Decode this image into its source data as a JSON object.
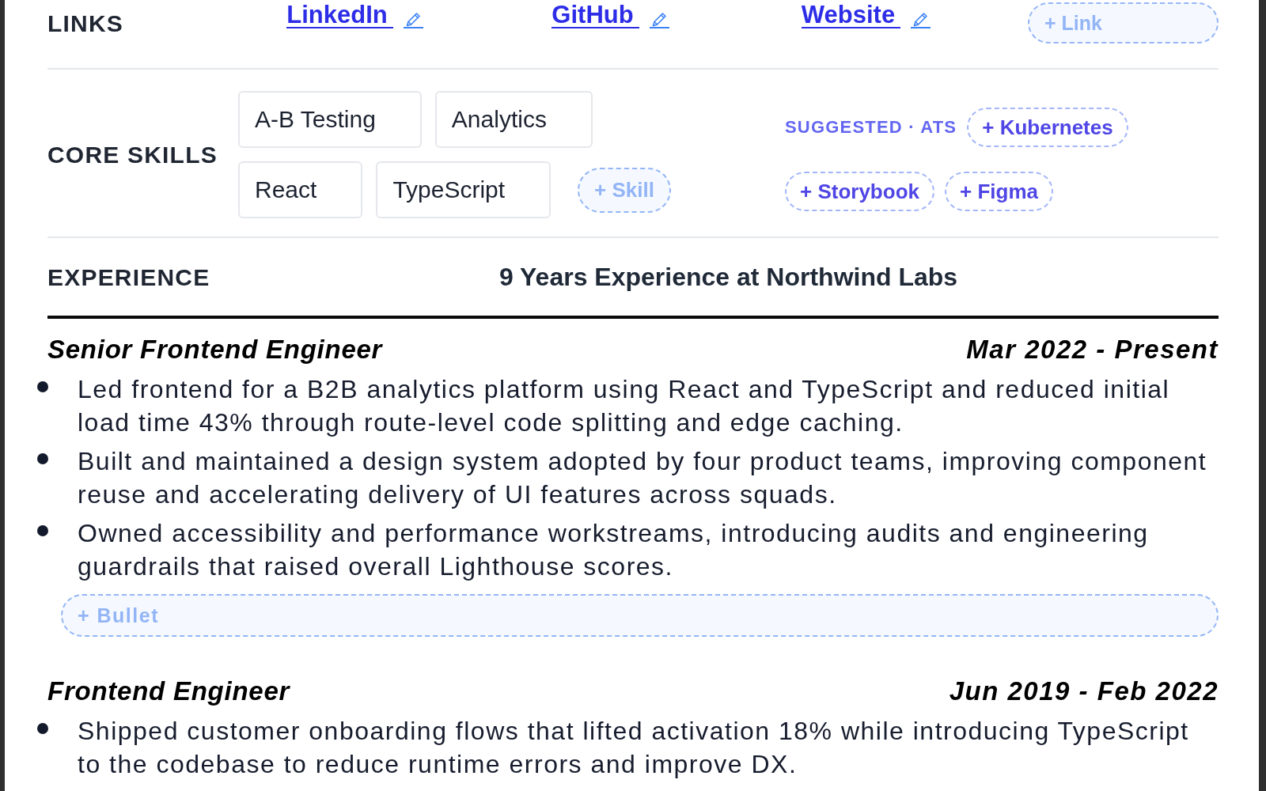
{
  "links": {
    "label": "LINKS",
    "items": [
      {
        "text": "LinkedIn"
      },
      {
        "text": "GitHub"
      },
      {
        "text": "Website"
      }
    ],
    "add_button": "+ Link"
  },
  "skills": {
    "label": "CORE SKILLS",
    "items": [
      "A-B Testing",
      "Analytics",
      "React",
      "TypeScript"
    ],
    "add_button": "+ Skill",
    "suggested": {
      "label": "SUGGESTED · ATS",
      "items": [
        "+ Kubernetes",
        "+ Storybook",
        "+ Figma"
      ]
    }
  },
  "experience": {
    "label": "EXPERIENCE",
    "summary": "9 Years Experience at Northwind Labs",
    "jobs": [
      {
        "title": "Senior Frontend Engineer",
        "dates": "Mar 2022 - Present",
        "bullets": [
          "Led frontend for a B2B analytics platform using React and TypeScript and reduced initial load time 43% through route-level code splitting and edge caching.",
          "Built and maintained a design system adopted by four product teams, improving component reuse and accelerating delivery of UI features across squads.",
          "Owned accessibility and performance workstreams, introducing audits and engineering guardrails that raised overall Lighthouse scores."
        ],
        "add_bullet": "+ Bullet"
      },
      {
        "title": "Frontend Engineer",
        "dates": "Jun 2019 - Feb 2022",
        "bullets": [
          "Shipped customer onboarding flows that lifted activation 18% while introducing TypeScript to the codebase to reduce runtime errors and improve DX."
        ]
      }
    ]
  }
}
